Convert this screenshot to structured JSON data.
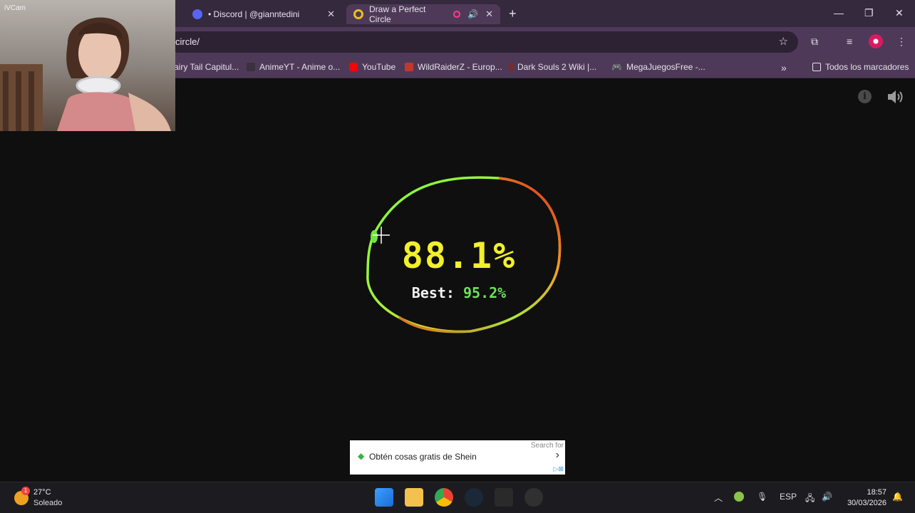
{
  "tabs": [
    {
      "title": "• Discord | @gianntedini",
      "favicon": "discord-icon",
      "active": false
    },
    {
      "title": "Draw a Perfect Circle",
      "favicon": "circle-game-icon",
      "active": true
    }
  ],
  "address": {
    "url": "circle/"
  },
  "bookmarks": [
    {
      "label": "airy Tail Capitul...",
      "icon": "page-icon"
    },
    {
      "label": "AnimeYT - Anime o...",
      "icon": "page-icon"
    },
    {
      "label": "YouTube",
      "icon": "youtube-icon"
    },
    {
      "label": "WildRaiderZ - Europ...",
      "icon": "wildraiderz-icon"
    },
    {
      "label": "Dark Souls 2 Wiki |...",
      "icon": "wiki-icon"
    },
    {
      "label": "MegaJuegosFree -...",
      "icon": "gamepad-icon"
    },
    {
      "label": "Todos los marcadores",
      "icon": "folder-icon"
    }
  ],
  "webcam": {
    "label": "iVCam"
  },
  "game": {
    "score": "88.1%",
    "best_label": "Best:",
    "best_value": "95.2%",
    "colors": {
      "score": "#f2f02a",
      "best": "#6ee05c",
      "good": "#7dff3a",
      "bad": "#e02020"
    }
  },
  "ad": {
    "text": "Obtén cosas gratis de Shein",
    "search_label": "Search for"
  },
  "taskbar": {
    "weather_temp": "27°C",
    "weather_cond": "Soleado",
    "weather_badge": "1",
    "language": "ESP",
    "time": "18:57",
    "date": "30/03/2026",
    "apps": [
      "windows-start-icon",
      "file-explorer-icon",
      "chrome-icon",
      "steam-icon",
      "epic-games-icon",
      "obs-icon"
    ]
  }
}
